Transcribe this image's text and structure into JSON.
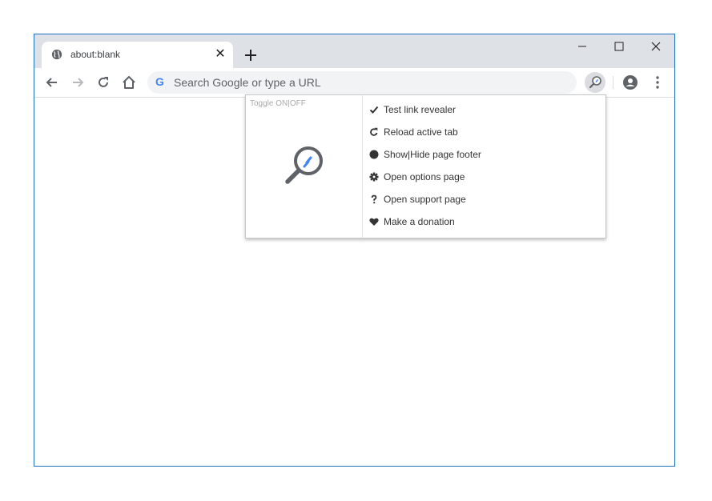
{
  "tab": {
    "title": "about:blank",
    "close_glyph": "✕"
  },
  "omnibox": {
    "google_glyph": "G",
    "placeholder": "Search Google or type a URL"
  },
  "popup": {
    "toggle_label": "Toggle ON|OFF",
    "items": [
      {
        "label": "Test link revealer",
        "icon": "check-icon"
      },
      {
        "label": "Reload active tab",
        "icon": "reload-icon"
      },
      {
        "label": "Show|Hide page footer",
        "icon": "circle-icon"
      },
      {
        "label": "Open options page",
        "icon": "gear-icon"
      },
      {
        "label": "Open support page",
        "icon": "question-icon"
      },
      {
        "label": "Make a donation",
        "icon": "heart-icon"
      }
    ]
  },
  "colors": {
    "accent": "#4285f4",
    "tabstrip": "#dee1e6",
    "icon": "#5f6368",
    "window_border": "#1f6fc5"
  }
}
